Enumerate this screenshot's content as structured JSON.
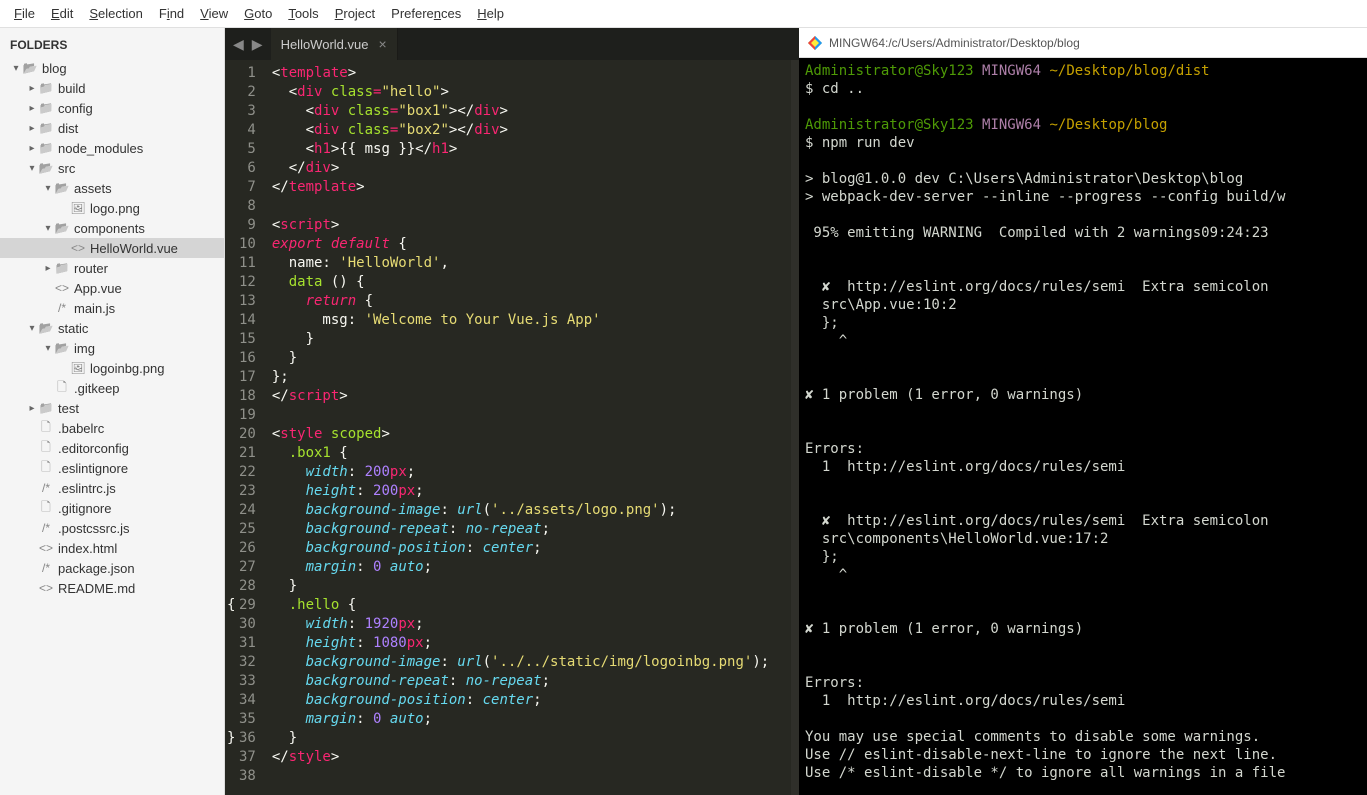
{
  "menu": [
    "File",
    "Edit",
    "Selection",
    "Find",
    "View",
    "Goto",
    "Tools",
    "Project",
    "Preferences",
    "Help"
  ],
  "menuKeys": [
    "F",
    "E",
    "S",
    "i",
    "V",
    "G",
    "T",
    "P",
    "n",
    "H"
  ],
  "sidebar": {
    "title": "FOLDERS",
    "tree": [
      {
        "depth": 0,
        "arrow": "▾",
        "icon": "folder-open",
        "label": "blog"
      },
      {
        "depth": 1,
        "arrow": "▸",
        "icon": "folder",
        "label": "build"
      },
      {
        "depth": 1,
        "arrow": "▸",
        "icon": "folder",
        "label": "config"
      },
      {
        "depth": 1,
        "arrow": "▸",
        "icon": "folder",
        "label": "dist"
      },
      {
        "depth": 1,
        "arrow": "▸",
        "icon": "folder",
        "label": "node_modules"
      },
      {
        "depth": 1,
        "arrow": "▾",
        "icon": "folder-open",
        "label": "src"
      },
      {
        "depth": 2,
        "arrow": "▾",
        "icon": "folder-open",
        "label": "assets"
      },
      {
        "depth": 3,
        "arrow": "",
        "icon": "file",
        "glyph": "🖼",
        "label": "logo.png"
      },
      {
        "depth": 2,
        "arrow": "▾",
        "icon": "folder-open",
        "label": "components"
      },
      {
        "depth": 3,
        "arrow": "",
        "icon": "file",
        "glyph": "<>",
        "label": "HelloWorld.vue",
        "selected": true
      },
      {
        "depth": 2,
        "arrow": "▸",
        "icon": "folder",
        "label": "router"
      },
      {
        "depth": 2,
        "arrow": "",
        "icon": "file",
        "glyph": "<>",
        "label": "App.vue"
      },
      {
        "depth": 2,
        "arrow": "",
        "icon": "file",
        "glyph": "/*",
        "label": "main.js"
      },
      {
        "depth": 1,
        "arrow": "▾",
        "icon": "folder-open",
        "label": "static"
      },
      {
        "depth": 2,
        "arrow": "▾",
        "icon": "folder-open",
        "label": "img"
      },
      {
        "depth": 3,
        "arrow": "",
        "icon": "file",
        "glyph": "🖼",
        "label": "logoinbg.png"
      },
      {
        "depth": 2,
        "arrow": "",
        "icon": "file",
        "glyph": "🗋",
        "label": ".gitkeep"
      },
      {
        "depth": 1,
        "arrow": "▸",
        "icon": "folder",
        "label": "test"
      },
      {
        "depth": 1,
        "arrow": "",
        "icon": "file",
        "glyph": "🗋",
        "label": ".babelrc"
      },
      {
        "depth": 1,
        "arrow": "",
        "icon": "file",
        "glyph": "🗋",
        "label": ".editorconfig"
      },
      {
        "depth": 1,
        "arrow": "",
        "icon": "file",
        "glyph": "🗋",
        "label": ".eslintignore"
      },
      {
        "depth": 1,
        "arrow": "",
        "icon": "file",
        "glyph": "/*",
        "label": ".eslintrc.js"
      },
      {
        "depth": 1,
        "arrow": "",
        "icon": "file",
        "glyph": "🗋",
        "label": ".gitignore"
      },
      {
        "depth": 1,
        "arrow": "",
        "icon": "file",
        "glyph": "/*",
        "label": ".postcssrc.js"
      },
      {
        "depth": 1,
        "arrow": "",
        "icon": "file",
        "glyph": "<>",
        "label": "index.html"
      },
      {
        "depth": 1,
        "arrow": "",
        "icon": "file",
        "glyph": "/*",
        "label": "package.json"
      },
      {
        "depth": 1,
        "arrow": "",
        "icon": "file",
        "glyph": "<>",
        "label": "README.md"
      }
    ]
  },
  "tab": {
    "name": "HelloWorld.vue"
  },
  "code": {
    "lines": [
      [
        {
          "t": "bracket",
          "v": "<"
        },
        {
          "t": "tag",
          "v": "template"
        },
        {
          "t": "bracket",
          "v": ">"
        }
      ],
      [
        {
          "t": "plain",
          "v": "  "
        },
        {
          "t": "bracket",
          "v": "<"
        },
        {
          "t": "tag",
          "v": "div"
        },
        {
          "t": "plain",
          "v": " "
        },
        {
          "t": "attr",
          "v": "class"
        },
        {
          "t": "op",
          "v": "="
        },
        {
          "t": "str",
          "v": "\"hello\""
        },
        {
          "t": "bracket",
          "v": ">"
        }
      ],
      [
        {
          "t": "plain",
          "v": "    "
        },
        {
          "t": "bracket",
          "v": "<"
        },
        {
          "t": "tag",
          "v": "div"
        },
        {
          "t": "plain",
          "v": " "
        },
        {
          "t": "attr",
          "v": "class"
        },
        {
          "t": "op",
          "v": "="
        },
        {
          "t": "str",
          "v": "\"box1\""
        },
        {
          "t": "bracket",
          "v": "></"
        },
        {
          "t": "tag",
          "v": "div"
        },
        {
          "t": "bracket",
          "v": ">"
        }
      ],
      [
        {
          "t": "plain",
          "v": "    "
        },
        {
          "t": "bracket",
          "v": "<"
        },
        {
          "t": "tag",
          "v": "div"
        },
        {
          "t": "plain",
          "v": " "
        },
        {
          "t": "attr",
          "v": "class"
        },
        {
          "t": "op",
          "v": "="
        },
        {
          "t": "str",
          "v": "\"box2\""
        },
        {
          "t": "bracket",
          "v": "></"
        },
        {
          "t": "tag",
          "v": "div"
        },
        {
          "t": "bracket",
          "v": ">"
        }
      ],
      [
        {
          "t": "plain",
          "v": "    "
        },
        {
          "t": "bracket",
          "v": "<"
        },
        {
          "t": "tag",
          "v": "h1"
        },
        {
          "t": "bracket",
          "v": ">"
        },
        {
          "t": "plain",
          "v": "{{ msg }}"
        },
        {
          "t": "bracket",
          "v": "</"
        },
        {
          "t": "tag",
          "v": "h1"
        },
        {
          "t": "bracket",
          "v": ">"
        }
      ],
      [
        {
          "t": "plain",
          "v": "  "
        },
        {
          "t": "bracket",
          "v": "</"
        },
        {
          "t": "tag",
          "v": "div"
        },
        {
          "t": "bracket",
          "v": ">"
        }
      ],
      [
        {
          "t": "bracket",
          "v": "</"
        },
        {
          "t": "tag",
          "v": "template"
        },
        {
          "t": "bracket",
          "v": ">"
        }
      ],
      [],
      [
        {
          "t": "bracket",
          "v": "<"
        },
        {
          "t": "tag",
          "v": "script"
        },
        {
          "t": "bracket",
          "v": ">"
        }
      ],
      [
        {
          "t": "kw",
          "v": "export"
        },
        {
          "t": "plain",
          "v": " "
        },
        {
          "t": "kw",
          "v": "default"
        },
        {
          "t": "plain",
          "v": " {"
        }
      ],
      [
        {
          "t": "plain",
          "v": "  name: "
        },
        {
          "t": "str",
          "v": "'HelloWorld'"
        },
        {
          "t": "plain",
          "v": ","
        }
      ],
      [
        {
          "t": "plain",
          "v": "  "
        },
        {
          "t": "fn",
          "v": "data"
        },
        {
          "t": "plain",
          "v": " () {"
        }
      ],
      [
        {
          "t": "plain",
          "v": "    "
        },
        {
          "t": "kw",
          "v": "return"
        },
        {
          "t": "plain",
          "v": " {"
        }
      ],
      [
        {
          "t": "plain",
          "v": "      msg: "
        },
        {
          "t": "str",
          "v": "'Welcome to Your Vue.js App'"
        }
      ],
      [
        {
          "t": "plain",
          "v": "    }"
        }
      ],
      [
        {
          "t": "plain",
          "v": "  }"
        }
      ],
      [
        {
          "t": "plain",
          "v": "};"
        }
      ],
      [
        {
          "t": "bracket",
          "v": "</"
        },
        {
          "t": "tag",
          "v": "script"
        },
        {
          "t": "bracket",
          "v": ">"
        }
      ],
      [],
      [
        {
          "t": "bracket",
          "v": "<"
        },
        {
          "t": "tag",
          "v": "style"
        },
        {
          "t": "plain",
          "v": " "
        },
        {
          "t": "attr",
          "v": "scoped"
        },
        {
          "t": "bracket",
          "v": ">"
        }
      ],
      [
        {
          "t": "plain",
          "v": "  "
        },
        {
          "t": "sel",
          "v": ".box1"
        },
        {
          "t": "plain",
          "v": " {"
        }
      ],
      [
        {
          "t": "plain",
          "v": "    "
        },
        {
          "t": "prop",
          "v": "width"
        },
        {
          "t": "punc",
          "v": ": "
        },
        {
          "t": "num",
          "v": "200"
        },
        {
          "t": "unit",
          "v": "px"
        },
        {
          "t": "punc",
          "v": ";"
        }
      ],
      [
        {
          "t": "plain",
          "v": "    "
        },
        {
          "t": "prop",
          "v": "height"
        },
        {
          "t": "punc",
          "v": ": "
        },
        {
          "t": "num",
          "v": "200"
        },
        {
          "t": "unit",
          "v": "px"
        },
        {
          "t": "punc",
          "v": ";"
        }
      ],
      [
        {
          "t": "plain",
          "v": "    "
        },
        {
          "t": "prop",
          "v": "background-image"
        },
        {
          "t": "punc",
          "v": ": "
        },
        {
          "t": "kw2",
          "v": "url"
        },
        {
          "t": "punc",
          "v": "("
        },
        {
          "t": "str",
          "v": "'../assets/logo.png'"
        },
        {
          "t": "punc",
          "v": ");"
        }
      ],
      [
        {
          "t": "plain",
          "v": "    "
        },
        {
          "t": "prop",
          "v": "background-repeat"
        },
        {
          "t": "punc",
          "v": ": "
        },
        {
          "t": "kw2",
          "v": "no-repeat"
        },
        {
          "t": "punc",
          "v": ";"
        }
      ],
      [
        {
          "t": "plain",
          "v": "    "
        },
        {
          "t": "prop",
          "v": "background-position"
        },
        {
          "t": "punc",
          "v": ": "
        },
        {
          "t": "kw2",
          "v": "center"
        },
        {
          "t": "punc",
          "v": ";"
        }
      ],
      [
        {
          "t": "plain",
          "v": "    "
        },
        {
          "t": "prop",
          "v": "margin"
        },
        {
          "t": "punc",
          "v": ": "
        },
        {
          "t": "num",
          "v": "0"
        },
        {
          "t": "plain",
          "v": " "
        },
        {
          "t": "kw2",
          "v": "auto"
        },
        {
          "t": "punc",
          "v": ";"
        }
      ],
      [
        {
          "t": "plain",
          "v": "  }"
        }
      ],
      [
        {
          "t": "plain",
          "v": "  "
        },
        {
          "t": "sel",
          "v": ".hello"
        },
        {
          "t": "plain",
          "v": " {"
        }
      ],
      [
        {
          "t": "plain",
          "v": "    "
        },
        {
          "t": "prop",
          "v": "width"
        },
        {
          "t": "punc",
          "v": ": "
        },
        {
          "t": "num",
          "v": "1920"
        },
        {
          "t": "unit",
          "v": "px"
        },
        {
          "t": "punc",
          "v": ";"
        }
      ],
      [
        {
          "t": "plain",
          "v": "    "
        },
        {
          "t": "prop",
          "v": "height"
        },
        {
          "t": "punc",
          "v": ": "
        },
        {
          "t": "num",
          "v": "1080"
        },
        {
          "t": "unit",
          "v": "px"
        },
        {
          "t": "punc",
          "v": ";"
        }
      ],
      [
        {
          "t": "plain",
          "v": "    "
        },
        {
          "t": "prop",
          "v": "background-image"
        },
        {
          "t": "punc",
          "v": ": "
        },
        {
          "t": "kw2",
          "v": "url"
        },
        {
          "t": "punc",
          "v": "("
        },
        {
          "t": "str",
          "v": "'../../static/img/logoinbg.png'"
        },
        {
          "t": "punc",
          "v": ");"
        }
      ],
      [
        {
          "t": "plain",
          "v": "    "
        },
        {
          "t": "prop",
          "v": "background-repeat"
        },
        {
          "t": "punc",
          "v": ": "
        },
        {
          "t": "kw2",
          "v": "no-repeat"
        },
        {
          "t": "punc",
          "v": ";"
        }
      ],
      [
        {
          "t": "plain",
          "v": "    "
        },
        {
          "t": "prop",
          "v": "background-position"
        },
        {
          "t": "punc",
          "v": ": "
        },
        {
          "t": "kw2",
          "v": "center"
        },
        {
          "t": "punc",
          "v": ";"
        }
      ],
      [
        {
          "t": "plain",
          "v": "    "
        },
        {
          "t": "prop",
          "v": "margin"
        },
        {
          "t": "punc",
          "v": ": "
        },
        {
          "t": "num",
          "v": "0"
        },
        {
          "t": "plain",
          "v": " "
        },
        {
          "t": "kw2",
          "v": "auto"
        },
        {
          "t": "punc",
          "v": ";"
        }
      ],
      [
        {
          "t": "plain",
          "v": "  }"
        }
      ],
      [
        {
          "t": "bracket",
          "v": "</"
        },
        {
          "t": "tag",
          "v": "style"
        },
        {
          "t": "bracket",
          "v": ">"
        }
      ],
      []
    ],
    "marks": {
      "29": "{",
      "36": "}"
    }
  },
  "terminal": {
    "title": "MINGW64:/c/Users/Administrator/Desktop/blog",
    "lines": [
      [
        {
          "c": "green",
          "v": "Administrator@Sky123"
        },
        {
          "c": "white",
          "v": " "
        },
        {
          "c": "magenta",
          "v": "MINGW64"
        },
        {
          "c": "white",
          "v": " "
        },
        {
          "c": "yellow",
          "v": "~/Desktop/blog/dist"
        }
      ],
      [
        {
          "c": "white",
          "v": "$ cd .."
        }
      ],
      [],
      [
        {
          "c": "green",
          "v": "Administrator@Sky123"
        },
        {
          "c": "white",
          "v": " "
        },
        {
          "c": "magenta",
          "v": "MINGW64"
        },
        {
          "c": "white",
          "v": " "
        },
        {
          "c": "yellow",
          "v": "~/Desktop/blog"
        }
      ],
      [
        {
          "c": "white",
          "v": "$ npm run dev"
        }
      ],
      [],
      [
        {
          "c": "white",
          "v": "> blog@1.0.0 dev C:\\Users\\Administrator\\Desktop\\blog"
        }
      ],
      [
        {
          "c": "white",
          "v": "> webpack-dev-server --inline --progress --config build/w"
        }
      ],
      [],
      [
        {
          "c": "white",
          "v": " 95% emitting WARNING  Compiled with 2 warnings09:24:23"
        }
      ],
      [],
      [],
      [
        {
          "c": "white",
          "v": "  ✘  http://eslint.org/docs/rules/semi  Extra semicolon"
        }
      ],
      [
        {
          "c": "white",
          "v": "  src\\App.vue:10:2"
        }
      ],
      [
        {
          "c": "white",
          "v": "  };"
        }
      ],
      [
        {
          "c": "white",
          "v": "    ^"
        }
      ],
      [],
      [],
      [
        {
          "c": "white",
          "v": "✘ 1 problem (1 error, 0 warnings)"
        }
      ],
      [],
      [],
      [
        {
          "c": "white",
          "v": "Errors:"
        }
      ],
      [
        {
          "c": "white",
          "v": "  1  http://eslint.org/docs/rules/semi"
        }
      ],
      [],
      [],
      [
        {
          "c": "white",
          "v": "  ✘  http://eslint.org/docs/rules/semi  Extra semicolon"
        }
      ],
      [
        {
          "c": "white",
          "v": "  src\\components\\HelloWorld.vue:17:2"
        }
      ],
      [
        {
          "c": "white",
          "v": "  };"
        }
      ],
      [
        {
          "c": "white",
          "v": "    ^"
        }
      ],
      [],
      [],
      [
        {
          "c": "white",
          "v": "✘ 1 problem (1 error, 0 warnings)"
        }
      ],
      [],
      [],
      [
        {
          "c": "white",
          "v": "Errors:"
        }
      ],
      [
        {
          "c": "white",
          "v": "  1  http://eslint.org/docs/rules/semi"
        }
      ],
      [],
      [
        {
          "c": "white",
          "v": "You may use special comments to disable some warnings."
        }
      ],
      [
        {
          "c": "white",
          "v": "Use // eslint-disable-next-line to ignore the next line."
        }
      ],
      [
        {
          "c": "white",
          "v": "Use /* eslint-disable */ to ignore all warnings in a file"
        }
      ]
    ]
  }
}
